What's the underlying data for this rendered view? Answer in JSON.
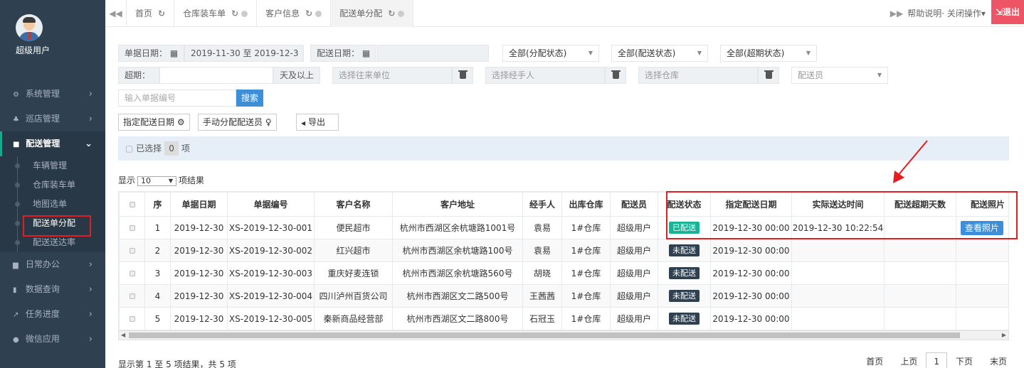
{
  "sidebar": {
    "user": "超级用户",
    "menu": [
      {
        "label": "系统管理",
        "icon": "gear-icon"
      },
      {
        "label": "巡店管理",
        "icon": "sitemap-icon"
      },
      {
        "label": "配送管理",
        "icon": "truck-icon"
      },
      {
        "label": "日常办公",
        "icon": "briefcase-icon"
      },
      {
        "label": "数据查询",
        "icon": "bar-chart-icon"
      },
      {
        "label": "任务进度",
        "icon": "line-chart-icon"
      },
      {
        "label": "微信应用",
        "icon": "wechat-icon"
      }
    ],
    "submenu": [
      "车辆管理",
      "仓库装车单",
      "地图选单",
      "配送单分配",
      "配送送达率"
    ]
  },
  "tabs": [
    {
      "label": "首页"
    },
    {
      "label": "仓库装车单"
    },
    {
      "label": "客户信息"
    },
    {
      "label": "配送单分配"
    }
  ],
  "topright": {
    "help": "帮助说明",
    "close_ops": "关闭操作",
    "logout": "退出"
  },
  "filters": {
    "doc_date_label": "单据日期：",
    "doc_date_value": "2019-11-30 至 2019-12-3",
    "ship_date_label": "配送日期：",
    "alloc_status": "全部(分配状态)",
    "ship_status": "全部(配送状态)",
    "overdue_status": "全部(超期状态)",
    "overdue_label": "超期：",
    "overdue_suffix": "天及以上",
    "partner_placeholder": "选择往来单位",
    "handler_placeholder": "选择经手人",
    "warehouse_placeholder": "选择仓库",
    "courier_placeholder": "配送员",
    "docno_placeholder": "输入单据编号",
    "search": "搜索"
  },
  "actions": {
    "assign_date": "指定配送日期",
    "assign_courier": "手动分配配送员",
    "export": "导出"
  },
  "selection": {
    "prefix": "已选择",
    "count": "0",
    "suffix": "项"
  },
  "pagesize": {
    "prefix": "显示",
    "value": "10",
    "suffix": "项结果"
  },
  "table": {
    "headers": [
      "序",
      "单据日期",
      "单据编号",
      "客户名称",
      "客户地址",
      "经手人",
      "出库仓库",
      "配送员",
      "配送状态",
      "指定配送日期",
      "实际送达时间",
      "配送超期天数",
      "配送照片"
    ],
    "rows": [
      {
        "no": "1",
        "date": "2019-12-30",
        "code": "XS-2019-12-30-001",
        "customer": "便民超市",
        "address": "杭州市西湖区余杭塘路1001号",
        "handler": "袁易",
        "warehouse": "1#仓库",
        "courier": "超级用户",
        "status": "已配送",
        "done": true,
        "assigned": "2019-12-30 00:00",
        "arrived": "2019-12-30 10:22:54",
        "overdue": "",
        "photo": "查看照片"
      },
      {
        "no": "2",
        "date": "2019-12-30",
        "code": "XS-2019-12-30-002",
        "customer": "红兴超市",
        "address": "杭州市西湖区余杭塘路100号",
        "handler": "袁易",
        "warehouse": "1#仓库",
        "courier": "超级用户",
        "status": "未配送",
        "done": false,
        "assigned": "2019-12-30 00:00",
        "arrived": "",
        "overdue": "",
        "photo": ""
      },
      {
        "no": "3",
        "date": "2019-12-30",
        "code": "XS-2019-12-30-003",
        "customer": "重庆好麦连锁",
        "address": "杭州市西湖区余杭塘路560号",
        "handler": "胡晓",
        "warehouse": "1#仓库",
        "courier": "超级用户",
        "status": "未配送",
        "done": false,
        "assigned": "2019-12-30 00:00",
        "arrived": "",
        "overdue": "",
        "photo": ""
      },
      {
        "no": "4",
        "date": "2019-12-30",
        "code": "XS-2019-12-30-004",
        "customer": "四川泸州百货公司",
        "address": "杭州市西湖区文二路500号",
        "handler": "王茜茜",
        "warehouse": "1#仓库",
        "courier": "超级用户",
        "status": "未配送",
        "done": false,
        "assigned": "2019-12-30 00:00",
        "arrived": "",
        "overdue": "",
        "photo": ""
      },
      {
        "no": "5",
        "date": "2019-12-30",
        "code": "XS-2019-12-30-005",
        "customer": "秦新商品经营部",
        "address": "杭州市西湖区文二路800号",
        "handler": "石冠玉",
        "warehouse": "1#仓库",
        "courier": "超级用户",
        "status": "未配送",
        "done": false,
        "assigned": "2019-12-30 00:00",
        "arrived": "",
        "overdue": "",
        "photo": ""
      }
    ]
  },
  "footer": {
    "summary": "显示第 1 至 5 项结果，共 5 项",
    "first": "首页",
    "prev": "上页",
    "current": "1",
    "next": "下页",
    "last": "末页"
  }
}
